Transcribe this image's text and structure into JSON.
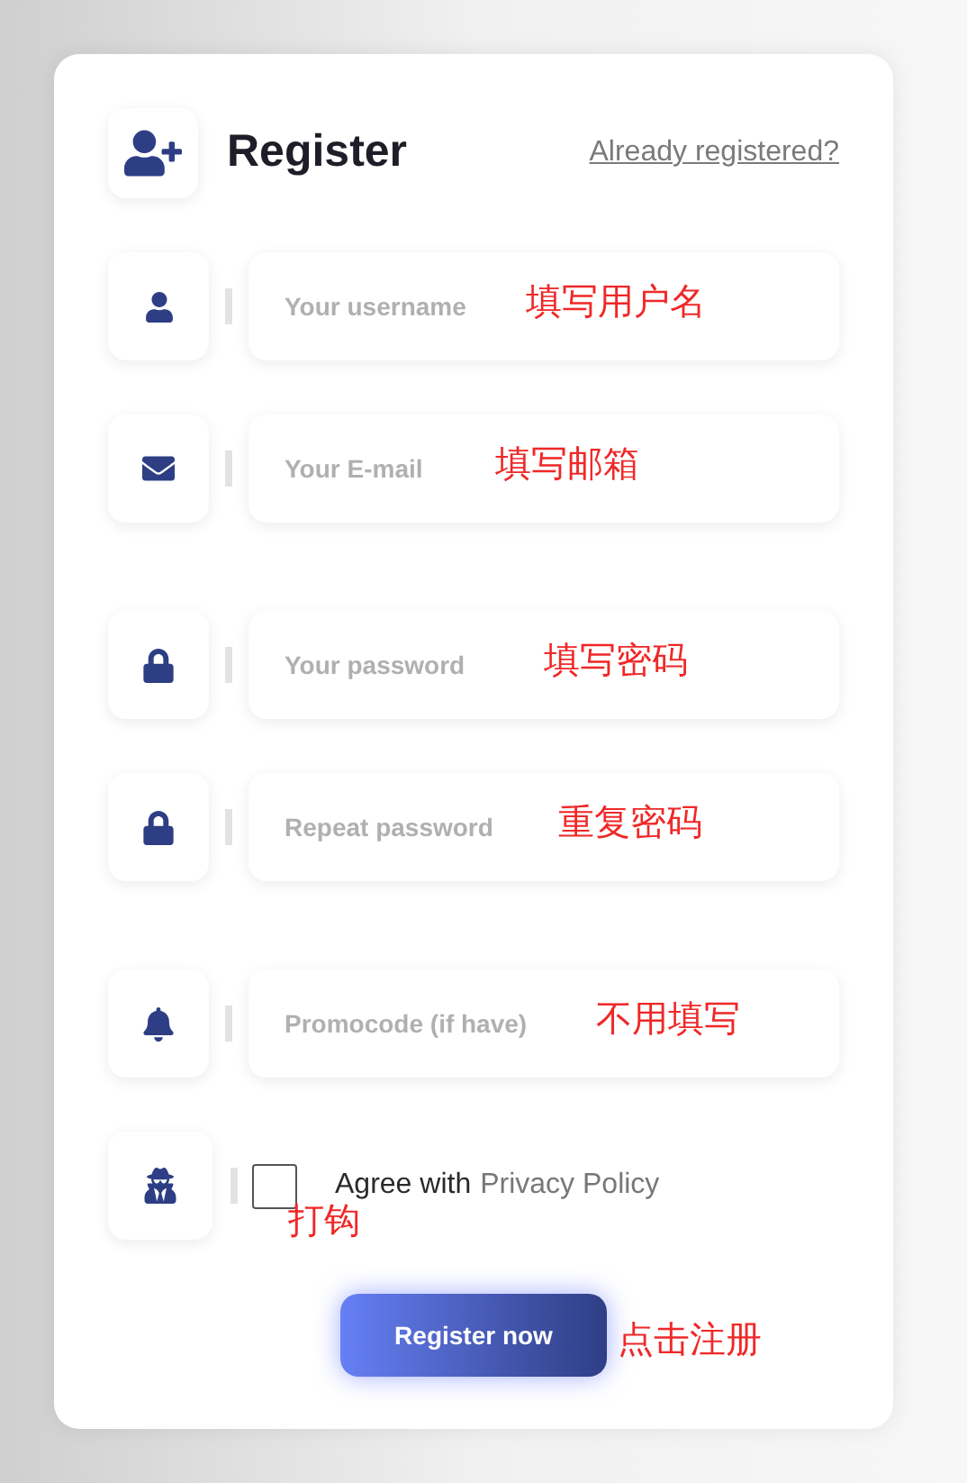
{
  "header": {
    "title": "Register",
    "login_link": "Already registered?"
  },
  "fields": [
    {
      "kind": "user",
      "placeholder": "Your username",
      "annotation": "填写用户名"
    },
    {
      "kind": "email",
      "placeholder": "Your E-mail",
      "annotation": "填写邮箱"
    },
    {
      "kind": "lock",
      "placeholder": "Your password",
      "annotation": "填写密码"
    },
    {
      "kind": "lock",
      "placeholder": "Repeat password",
      "annotation": "重复密码"
    },
    {
      "kind": "bell",
      "placeholder": "Promocode (if have)",
      "annotation": "不用填写"
    }
  ],
  "agree": {
    "checked": false,
    "text": "Agree with",
    "link": "Privacy Policy",
    "annotation": "打钩"
  },
  "submit": {
    "label": "Register now",
    "annotation": "点击注册"
  }
}
